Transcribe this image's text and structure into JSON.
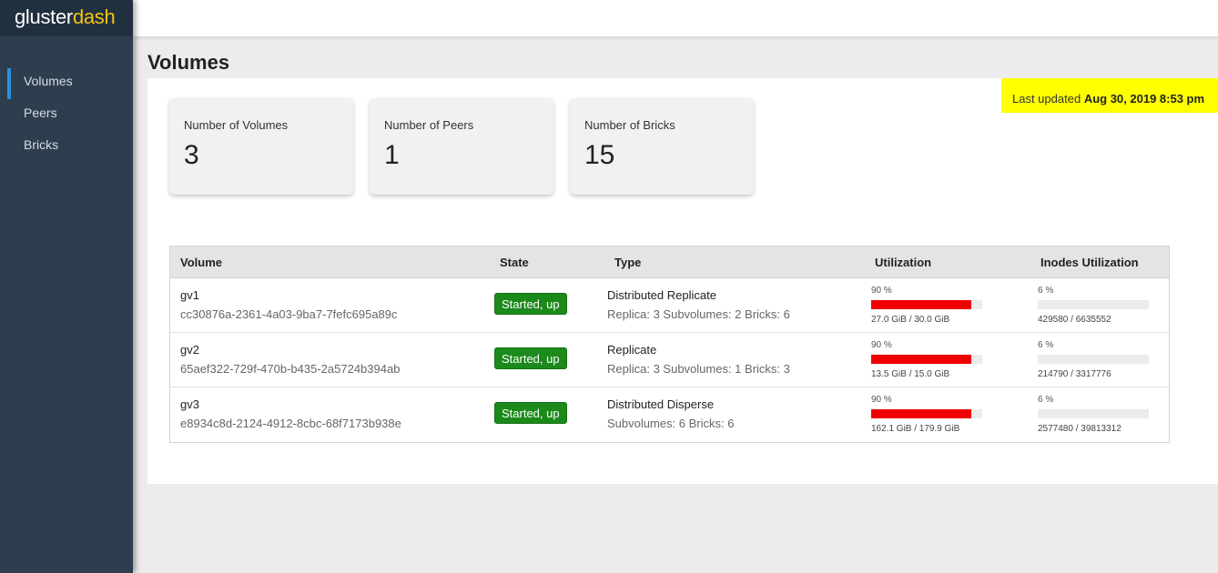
{
  "brand": {
    "prefix": "gluster",
    "suffix": "dash"
  },
  "sidebar": {
    "items": [
      {
        "label": "Volumes",
        "active": true
      },
      {
        "label": "Peers",
        "active": false
      },
      {
        "label": "Bricks",
        "active": false
      }
    ]
  },
  "page": {
    "title": "Volumes"
  },
  "last_updated": {
    "label": "Last updated",
    "value": "Aug 30, 2019 8:53 pm"
  },
  "summary": [
    {
      "label": "Number of Volumes",
      "value": "3"
    },
    {
      "label": "Number of Peers",
      "value": "1"
    },
    {
      "label": "Number of Bricks",
      "value": "15"
    }
  ],
  "table": {
    "headers": [
      "Volume",
      "State",
      "Type",
      "Utilization",
      "Inodes Utilization"
    ],
    "rows": [
      {
        "name": "gv1",
        "id": "cc30876a-2361-4a03-9ba7-7fefc695a89c",
        "state": "Started, up",
        "type": "Distributed Replicate",
        "type_detail": "Replica: 3 Subvolumes: 2 Bricks: 6",
        "util_pct": "90 %",
        "util_value": 90,
        "util_text": "27.0 GiB / 30.0 GiB",
        "inode_pct": "6 %",
        "inode_value": 6,
        "inode_text": "429580 / 6635552"
      },
      {
        "name": "gv2",
        "id": "65aef322-729f-470b-b435-2a5724b394ab",
        "state": "Started, up",
        "type": "Replicate",
        "type_detail": "Replica: 3 Subvolumes: 1 Bricks: 3",
        "util_pct": "90 %",
        "util_value": 90,
        "util_text": "13.5 GiB / 15.0 GiB",
        "inode_pct": "6 %",
        "inode_value": 6,
        "inode_text": "214790 / 3317776"
      },
      {
        "name": "gv3",
        "id": "e8934c8d-2124-4912-8cbc-68f7173b938e",
        "state": "Started, up",
        "type": "Distributed Disperse",
        "type_detail": "Subvolumes: 6 Bricks: 6",
        "util_pct": "90 %",
        "util_value": 90,
        "util_text": "162.1 GiB / 179.9 GiB",
        "inode_pct": "6 %",
        "inode_value": 6,
        "inode_text": "2577480 / 39813312"
      }
    ]
  },
  "colors": {
    "sidebar_bg": "#2e3e4f",
    "brand_accent": "#f3c511",
    "active_indicator": "#2b90e0",
    "state_badge": "#1b8a1b",
    "util_bar_high": "#f00000",
    "highlight": "#ffff00"
  }
}
